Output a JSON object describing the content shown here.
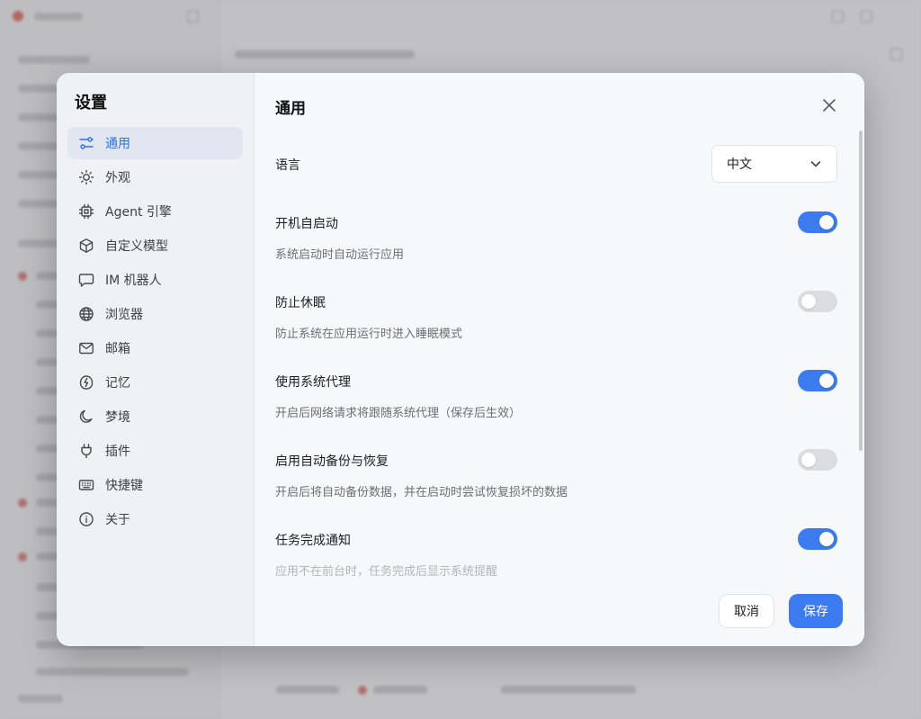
{
  "dialog": {
    "nav_title": "设置",
    "content_title": "通用",
    "nav_items": [
      {
        "label": "通用",
        "icon": "sliders-icon",
        "active": true
      },
      {
        "label": "外观",
        "icon": "sun-icon"
      },
      {
        "label": "Agent 引擎",
        "icon": "cpu-icon"
      },
      {
        "label": "自定义模型",
        "icon": "cube-icon"
      },
      {
        "label": "IM 机器人",
        "icon": "chat-bubble-icon"
      },
      {
        "label": "浏览器",
        "icon": "globe-icon"
      },
      {
        "label": "邮箱",
        "icon": "mail-icon"
      },
      {
        "label": "记忆",
        "icon": "brain-icon"
      },
      {
        "label": "梦境",
        "icon": "moon-icon"
      },
      {
        "label": "插件",
        "icon": "plug-icon"
      },
      {
        "label": "快捷键",
        "icon": "keyboard-icon"
      },
      {
        "label": "关于",
        "icon": "info-icon"
      }
    ],
    "language": {
      "label": "语言",
      "value": "中文"
    },
    "settings": [
      {
        "label": "开机自启动",
        "desc": "系统启动时自动运行应用",
        "enabled": true
      },
      {
        "label": "防止休眠",
        "desc": "防止系统在应用运行时进入睡眠模式",
        "enabled": false
      },
      {
        "label": "使用系统代理",
        "desc": "开启后网络请求将跟随系统代理（保存后生效）",
        "enabled": true
      },
      {
        "label": "启用自动备份与恢复",
        "desc": "开启后将自动备份数据，并在启动时尝试恢复损坏的数据",
        "enabled": false
      },
      {
        "label": "任务完成通知",
        "desc": "应用不在前台时，任务完成后显示系统提醒",
        "enabled": true
      }
    ],
    "buttons": {
      "cancel": "取消",
      "save": "保存"
    }
  },
  "colors": {
    "accent": "#3b7bef",
    "toggle_off": "#dcdde1",
    "nav_active_bg": "#e2e6f1"
  }
}
